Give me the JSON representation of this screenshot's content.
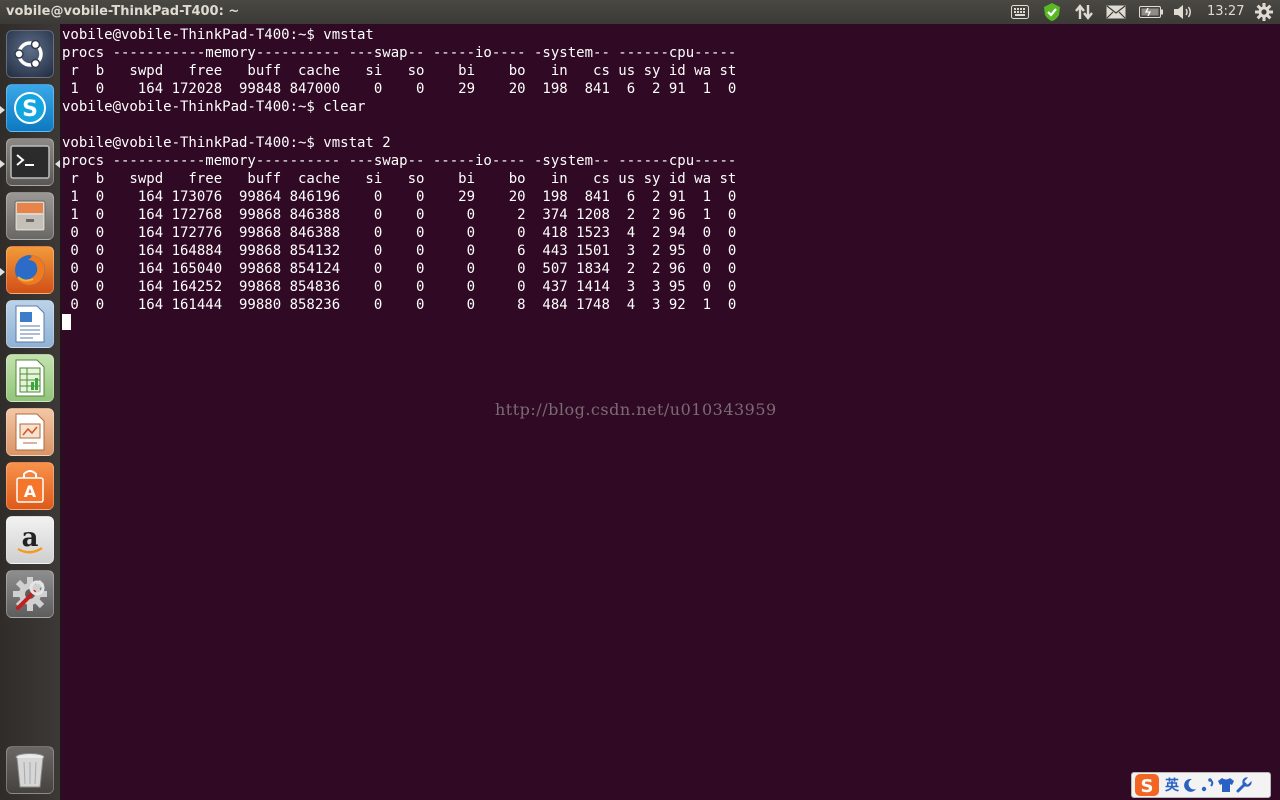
{
  "window": {
    "title": "vobile@vobile-ThinkPad-T400: ~"
  },
  "panel": {
    "clock": "13:27",
    "indicators": [
      "keyboard-icon",
      "update-check-icon",
      "network-transfer-icon",
      "mail-icon",
      "battery-icon",
      "volume-icon",
      "settings-gear-icon"
    ]
  },
  "launcher": {
    "items": [
      {
        "name": "dash-home",
        "icon": "ubuntu-logo-icon"
      },
      {
        "name": "skype",
        "icon": "skype-icon"
      },
      {
        "name": "terminal",
        "icon": "terminal-icon"
      },
      {
        "name": "files",
        "icon": "file-cabinet-icon"
      },
      {
        "name": "firefox",
        "icon": "firefox-icon"
      },
      {
        "name": "libreoffice-writer",
        "icon": "writer-doc-icon"
      },
      {
        "name": "libreoffice-calc",
        "icon": "calc-sheet-icon"
      },
      {
        "name": "libreoffice-impress",
        "icon": "impress-slide-icon"
      },
      {
        "name": "software-center",
        "icon": "shopping-bag-icon"
      },
      {
        "name": "amazon",
        "icon": "amazon-icon"
      },
      {
        "name": "system-settings",
        "icon": "wrench-gear-icon"
      },
      {
        "name": "trash",
        "icon": "trash-icon"
      }
    ]
  },
  "terminal": {
    "lines": [
      "vobile@vobile-ThinkPad-T400:~$ vmstat",
      "procs -----------memory---------- ---swap-- -----io---- -system-- ------cpu-----",
      " r  b   swpd   free   buff  cache   si   so    bi    bo   in   cs us sy id wa st",
      " 1  0    164 172028  99848 847000    0    0    29    20  198  841  6  2 91  1  0",
      "vobile@vobile-ThinkPad-T400:~$ clear",
      "",
      "vobile@vobile-ThinkPad-T400:~$ vmstat 2",
      "procs -----------memory---------- ---swap-- -----io---- -system-- ------cpu-----",
      " r  b   swpd   free   buff  cache   si   so    bi    bo   in   cs us sy id wa st",
      " 1  0    164 173076  99864 846196    0    0    29    20  198  841  6  2 91  1  0",
      " 1  0    164 172768  99868 846388    0    0     0     2  374 1208  2  2 96  1  0",
      " 0  0    164 172776  99868 846388    0    0     0     0  418 1523  4  2 94  0  0",
      " 0  0    164 164884  99868 854132    0    0     0     6  443 1501  3  2 95  0  0",
      " 0  0    164 165040  99868 854124    0    0     0     0  507 1834  2  2 96  0  0",
      " 0  0    164 164252  99868 854836    0    0     0     0  437 1414  3  3 95  0  0",
      " 0  0    164 161444  99880 858236    0    0     0     8  484 1748  4  3 92  1  0"
    ]
  },
  "watermark": "http://blog.csdn.net/u010343959",
  "ime": {
    "logo": "S",
    "mode": "英",
    "items": [
      "moon-icon",
      "punctuation-icon",
      "shirt-icon",
      "wrench-icon"
    ]
  },
  "colors": {
    "terminal_bg": "#300a24",
    "panel_bg": "#3c3b37",
    "launcher_bg": "#33302e",
    "ime_accent": "#2a62c4",
    "sogou_orange": "#f26522"
  }
}
